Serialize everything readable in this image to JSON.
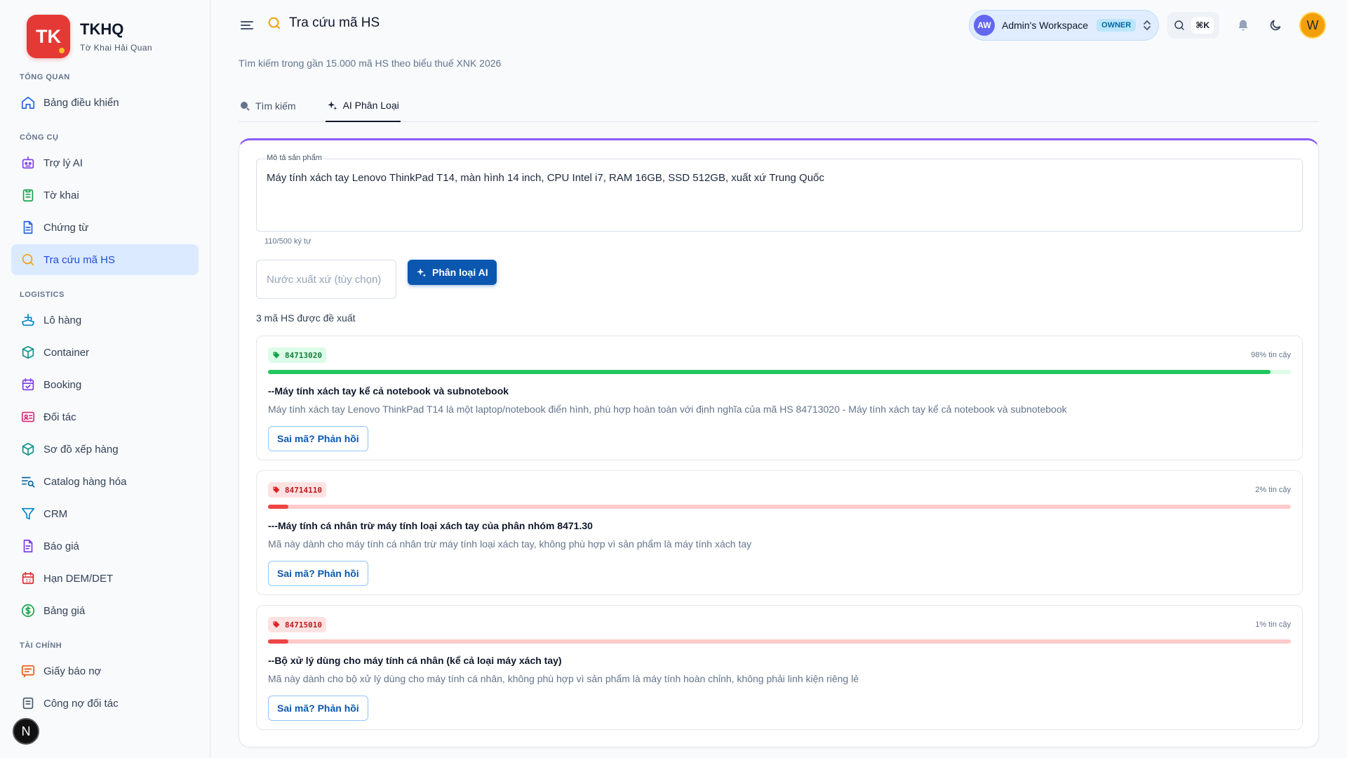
{
  "brand": {
    "logo_text": "TK",
    "title": "TKHQ",
    "subtitle": "Tờ Khai Hải Quan"
  },
  "sidebar": {
    "sections": [
      {
        "label": "TỔNG QUAN",
        "items": [
          {
            "label": "Bảng điều khiển",
            "icon": "home-icon"
          }
        ]
      },
      {
        "label": "CÔNG CỤ",
        "items": [
          {
            "label": "Trợ lý AI",
            "icon": "robot-icon"
          },
          {
            "label": "Tờ khai",
            "icon": "clipboard-icon"
          },
          {
            "label": "Chứng từ",
            "icon": "document-icon"
          },
          {
            "label": "Tra cứu mã HS",
            "icon": "search-icon",
            "active": true
          }
        ]
      },
      {
        "label": "LOGISTICS",
        "items": [
          {
            "label": "Lô hàng",
            "icon": "ship-icon"
          },
          {
            "label": "Container",
            "icon": "box-icon"
          },
          {
            "label": "Booking",
            "icon": "calendar-check-icon"
          },
          {
            "label": "Đối tác",
            "icon": "contact-card-icon"
          },
          {
            "label": "Sơ đồ xếp hàng",
            "icon": "cube-icon"
          },
          {
            "label": "Catalog hàng hóa",
            "icon": "list-search-icon"
          },
          {
            "label": "CRM",
            "icon": "funnel-icon"
          },
          {
            "label": "Báo giá",
            "icon": "quote-doc-icon"
          },
          {
            "label": "Hạn DEM/DET",
            "icon": "calendar-12-icon"
          },
          {
            "label": "Bảng giá",
            "icon": "dollar-circle-icon"
          }
        ]
      },
      {
        "label": "TÀI CHÍNH",
        "items": [
          {
            "label": "Giấy báo nợ",
            "icon": "message-icon"
          },
          {
            "label": "Công nợ đối tác",
            "icon": "ledger-icon"
          }
        ]
      }
    ],
    "n_badge": "N"
  },
  "header": {
    "title": "Tra cứu mã HS",
    "subtitle": "Tìm kiếm trong gần 15.000 mã HS theo biểu thuế XNK 2026",
    "tabs": [
      {
        "label": "Tìm kiếm"
      },
      {
        "label": "AI Phân Loại",
        "active": true
      }
    ]
  },
  "topbar": {
    "workspace_initials": "AW",
    "workspace_name": "Admin's Workspace",
    "workspace_role": "OWNER",
    "shortcut": "⌘K",
    "user_initial": "W"
  },
  "form": {
    "desc_label": "Mô tả sản phẩm",
    "desc_value": "Máy tính xách tay Lenovo ThinkPad T14, màn hình 14 inch, CPU Intel i7, RAM 16GB, SSD 512GB, xuất xứ Trung Quốc",
    "char_count": "110/500 ký tự",
    "origin_placeholder": "Nước xuất xứ (tùy chọn)",
    "ai_button": "Phân loại AI"
  },
  "results": {
    "count_label": "3 mã HS được đề xuất",
    "feedback_label": "Sai mã? Phản hồi",
    "items": [
      {
        "code": "84713020",
        "confidence_label": "98% tin cậy",
        "confidence": 0.98,
        "status": "green",
        "title": "--Máy tính xách tay kể cả notebook và subnotebook",
        "desc": "Máy tính xách tay Lenovo ThinkPad T14 là một laptop/notebook điển hình, phù hợp hoàn toàn với định nghĩa của mã HS 84713020 - Máy tính xách tay kể cả notebook và subnotebook"
      },
      {
        "code": "84714110",
        "confidence_label": "2% tin cậy",
        "confidence": 0.02,
        "status": "red",
        "title": "---Máy tính cá nhân trừ máy tính loại xách tay của phân nhóm 8471.30",
        "desc": "Mã này dành cho máy tính cá nhân trừ máy tính loại xách tay, không phù hợp vì sản phẩm là máy tính xách tay"
      },
      {
        "code": "84715010",
        "confidence_label": "1% tin cậy",
        "confidence": 0.01,
        "status": "red",
        "title": "--Bộ xử lý dùng cho máy tính cá nhân (kể cả loại máy xách tay)",
        "desc": "Mã này dành cho bộ xử lý dùng cho máy tính cá nhân, không phù hợp vì sản phẩm là máy tính hoàn chỉnh, không phải linh kiện riêng lẻ"
      }
    ]
  },
  "colors": {
    "accent": "#0b57b0",
    "brand": "#e53935",
    "success": "#22c55e",
    "danger": "#ef4444",
    "card_top": "#8b5cf6"
  }
}
